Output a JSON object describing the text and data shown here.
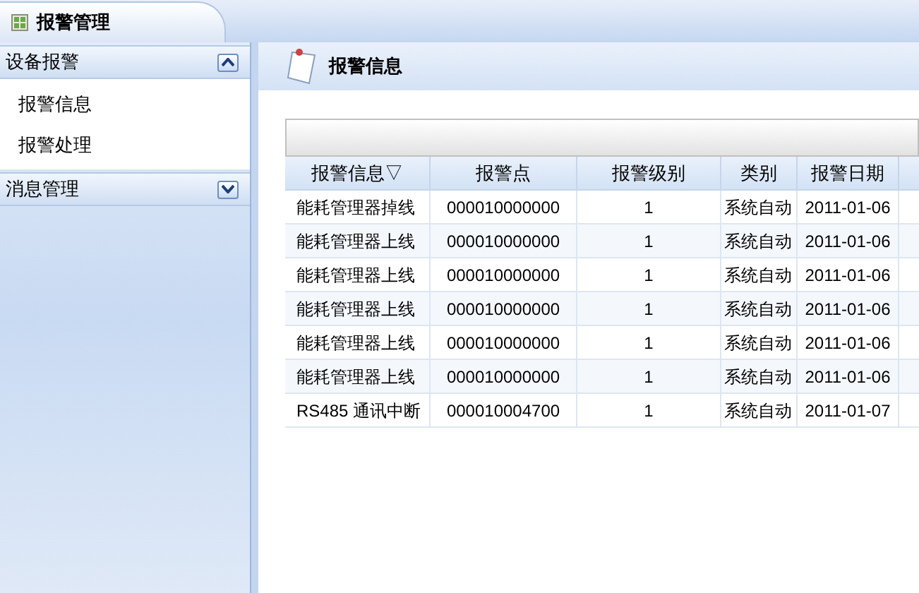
{
  "window": {
    "title": "报警管理"
  },
  "sidebar": {
    "groups": [
      {
        "title": "设备报警",
        "expanded": true,
        "items": [
          {
            "label": "报警信息"
          },
          {
            "label": "报警处理"
          }
        ]
      },
      {
        "title": "消息管理",
        "expanded": false
      }
    ]
  },
  "panel": {
    "title": "报警信息"
  },
  "table": {
    "columns": [
      "报警信息▽",
      "报警点",
      "报警级别",
      "类别",
      "报警日期"
    ],
    "rows": [
      [
        "能耗管理器掉线",
        "000010000000",
        "1",
        "系统自动",
        "2011-01-06"
      ],
      [
        "能耗管理器上线",
        "000010000000",
        "1",
        "系统自动",
        "2011-01-06"
      ],
      [
        "能耗管理器上线",
        "000010000000",
        "1",
        "系统自动",
        "2011-01-06"
      ],
      [
        "能耗管理器上线",
        "000010000000",
        "1",
        "系统自动",
        "2011-01-06"
      ],
      [
        "能耗管理器上线",
        "000010000000",
        "1",
        "系统自动",
        "2011-01-06"
      ],
      [
        "能耗管理器上线",
        "000010000000",
        "1",
        "系统自动",
        "2011-01-06"
      ],
      [
        "RS485 通讯中断",
        "000010004700",
        "1",
        "系统自动",
        "2011-01-07"
      ]
    ]
  }
}
